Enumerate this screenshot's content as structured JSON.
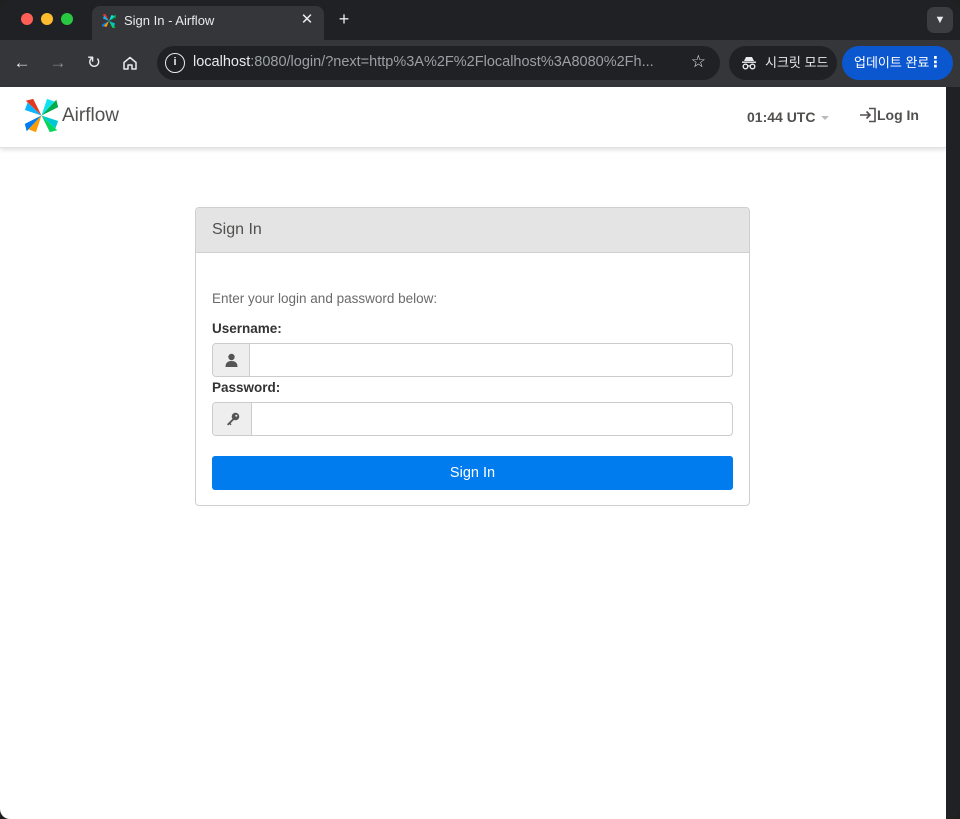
{
  "browser": {
    "tab": {
      "title": "Sign In - Airflow",
      "close_icon": "close-icon"
    },
    "new_tab_label": "+",
    "address_bar": {
      "url_host": "localhost",
      "url_rest": ":8080/login/?next=http%3A%2F%2Flocalhost%3A8080%2Fh..."
    },
    "incognito_label": "시크릿 모드",
    "update_label": "업데이트 완료",
    "colors": {
      "frame": "#202124",
      "toolbar": "#35363a",
      "update_button": "#0b57d0"
    }
  },
  "navbar": {
    "brand_name": "Airflow",
    "clock": "01:44 UTC",
    "login_label": "Log In"
  },
  "login_panel": {
    "title": "Sign In",
    "instruction": "Enter your login and password below:",
    "username_label": "Username:",
    "username_value": "",
    "password_label": "Password:",
    "password_value": "",
    "submit_label": "Sign In",
    "colors": {
      "submit": "#017cee",
      "heading_bg": "#e4e4e4"
    }
  }
}
